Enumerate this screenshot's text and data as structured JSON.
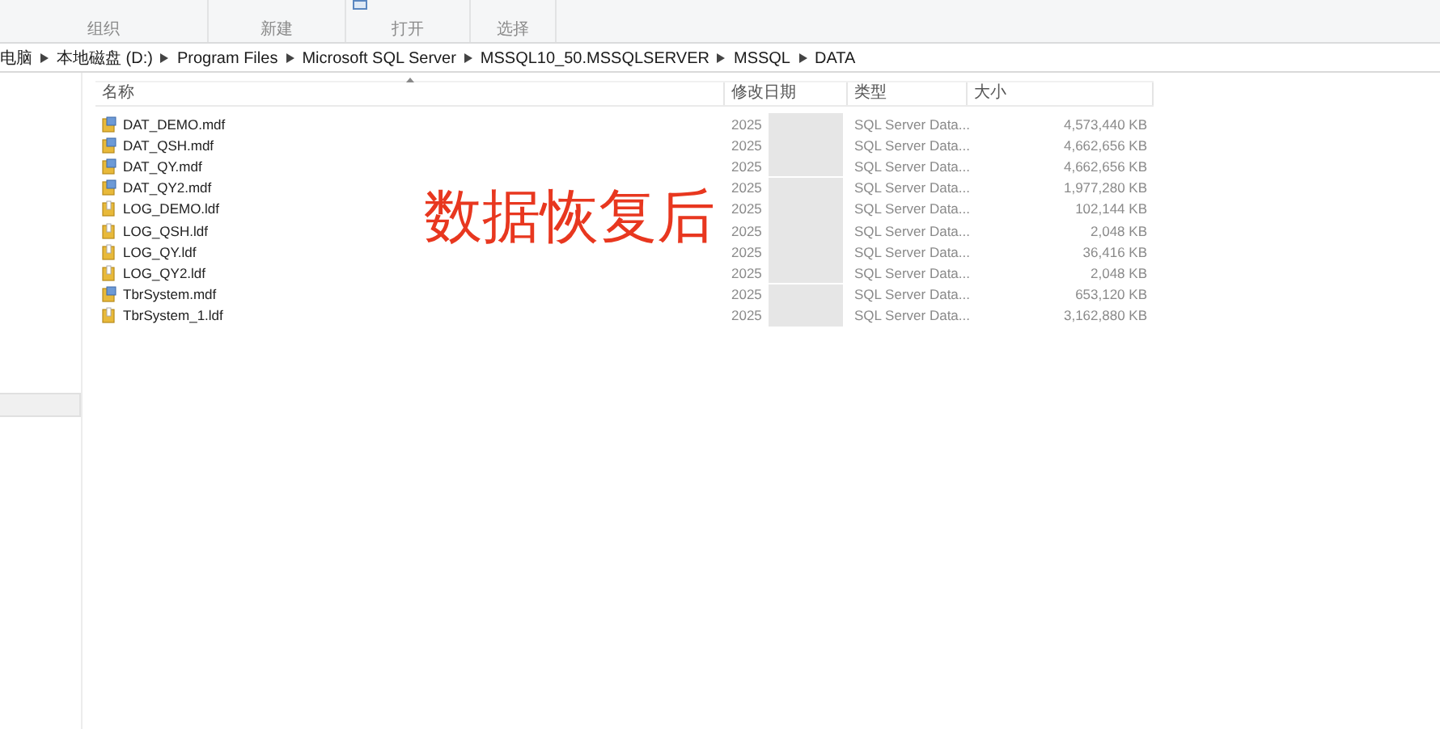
{
  "ribbon": {
    "groups": [
      "组织",
      "新建",
      "打开",
      "选择"
    ]
  },
  "breadcrumb": [
    "电脑",
    "本地磁盘 (D:)",
    "Program Files",
    "Microsoft SQL Server",
    "MSSQL10_50.MSSQLSERVER",
    "MSSQL",
    "DATA"
  ],
  "nav_pane": {
    "items": [
      {
        "selected": true
      }
    ]
  },
  "table": {
    "columns": [
      "名称",
      "修改日期",
      "类型",
      "大小"
    ],
    "rows": [
      {
        "name": "DAT_DEMO.mdf",
        "kind": "mdf",
        "date": "2025",
        "type": "SQL Server Data...",
        "size": "4,573,440 KB"
      },
      {
        "name": "DAT_QSH.mdf",
        "kind": "mdf",
        "date": "2025",
        "type": "SQL Server Data...",
        "size": "4,662,656 KB"
      },
      {
        "name": "DAT_QY.mdf",
        "kind": "mdf",
        "date": "2025",
        "type": "SQL Server Data...",
        "size": "4,662,656 KB"
      },
      {
        "name": "DAT_QY2.mdf",
        "kind": "mdf",
        "date": "2025",
        "type": "SQL Server Data...",
        "size": "1,977,280 KB"
      },
      {
        "name": "LOG_DEMO.ldf",
        "kind": "ldf",
        "date": "2025",
        "type": "SQL Server Data...",
        "size": "102,144 KB"
      },
      {
        "name": "LOG_QSH.ldf",
        "kind": "ldf",
        "date": "2025",
        "type": "SQL Server Data...",
        "size": "2,048 KB"
      },
      {
        "name": "LOG_QY.ldf",
        "kind": "ldf",
        "date": "2025",
        "type": "SQL Server Data...",
        "size": "36,416 KB"
      },
      {
        "name": "LOG_QY2.ldf",
        "kind": "ldf",
        "date": "2025",
        "type": "SQL Server Data...",
        "size": "2,048 KB"
      },
      {
        "name": "TbrSystem.mdf",
        "kind": "mdf",
        "date": "2025",
        "type": "SQL Server Data...",
        "size": "653,120 KB"
      },
      {
        "name": "TbrSystem_1.ldf",
        "kind": "ldf",
        "date": "2025",
        "type": "SQL Server Data...",
        "size": "3,162,880 KB"
      }
    ]
  },
  "overlay_caption": "数据恢复后"
}
